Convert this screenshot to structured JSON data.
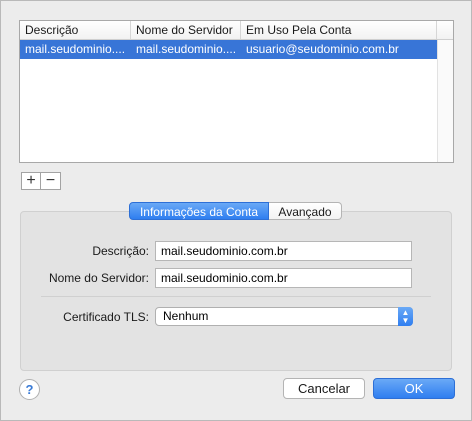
{
  "accounts_table": {
    "columns": [
      "Descrição",
      "Nome do Servidor",
      "Em Uso Pela Conta"
    ],
    "rows": [
      [
        "mail.seudominio....",
        "mail.seudominio....",
        "usuario@seudominio.com.br"
      ]
    ],
    "selected_row": 0
  },
  "list_controls": {
    "add_label": "+",
    "remove_label": "−"
  },
  "tabs": {
    "active": "Informações da Conta",
    "inactive": "Avançado"
  },
  "form": {
    "description_label": "Descrição:",
    "description_value": "mail.seudominio.com.br",
    "server_label": "Nome do Servidor:",
    "server_value": "mail.seudominio.com.br",
    "tls_label": "Certificado TLS:",
    "tls_value": "Nenhum"
  },
  "footer": {
    "help_label": "?",
    "cancel_label": "Cancelar",
    "ok_label": "OK"
  },
  "colors": {
    "accent": "#3875d7",
    "window_bg": "#ececec"
  },
  "icons": {
    "help": "help-icon",
    "select_arrows": "updown-chevron-icon"
  }
}
